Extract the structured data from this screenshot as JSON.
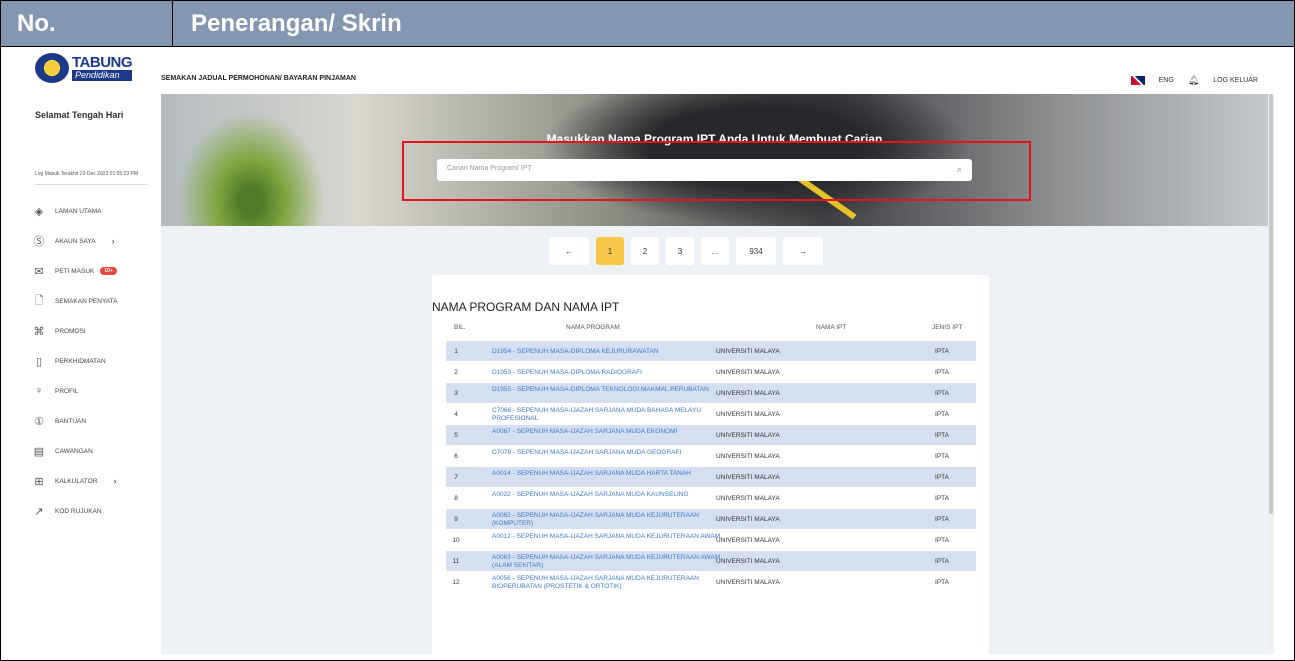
{
  "doc_header": {
    "no": "No.",
    "title": "Penerangan/ Skrin"
  },
  "topbar": {
    "logo_text": "TABUNG",
    "logo_sub": "Pendidikan",
    "app_title": "SEMAKAN JADUAL PERMOHONAN/ BAYARAN PINJAMAN",
    "lang": "ENG",
    "logout": "LOG KELUAR"
  },
  "sidebar": {
    "greeting": "Selamat Tengah Hari",
    "last_login": "Log Masuk Terakhir 29 Dec 2023 01:55:23 PM",
    "items": [
      {
        "label": "LAMAN UTAMA",
        "icon": "layers-icon"
      },
      {
        "label": "AKAUN SAYA",
        "icon": "dollar-icon",
        "chevron": "›"
      },
      {
        "label": "PETI MASUK",
        "icon": "mail-icon",
        "badge": "10+"
      },
      {
        "label": "SEMAKAN PENYATA",
        "icon": "document-icon"
      },
      {
        "label": "PROMOSI",
        "icon": "gift-icon"
      },
      {
        "label": "PERKHIDMATAN",
        "icon": "phone-icon"
      },
      {
        "label": "PROFIL",
        "icon": "user-icon"
      },
      {
        "label": "BANTUAN",
        "icon": "help-icon"
      },
      {
        "label": "CAWANGAN",
        "icon": "branch-icon"
      },
      {
        "label": "KALKULATOR",
        "icon": "calculator-icon",
        "chevron": "›"
      },
      {
        "label": "KOD RUJUKAN",
        "icon": "link-icon"
      }
    ]
  },
  "banner": {
    "heading": "Masukkan Nama Program IPT Anda Untuk Membuat Carian",
    "search_placeholder": "Carian Nama Program/ IPT"
  },
  "pagination": {
    "prev": "←",
    "pages": [
      "1",
      "2",
      "3",
      "...",
      "934"
    ],
    "next": "→",
    "active": "1"
  },
  "table": {
    "title": "NAMA PROGRAM DAN NAMA IPT",
    "headers": {
      "bil": "BIL.",
      "program": "NAMA PROGRAM",
      "ipt": "NAMA IPT",
      "jenis": "JENIS IPT"
    },
    "rows": [
      {
        "bil": "1",
        "program": "D1954 - SEPENUH MASA-DIPLOMA KEJURURAWATAN",
        "ipt": "UNIVERSITI MALAYA",
        "jenis": "IPTA"
      },
      {
        "bil": "2",
        "program": "D1953 - SEPENUH MASA-DIPLOMA RADIOGRAFI",
        "ipt": "UNIVERSITI MALAYA",
        "jenis": "IPTA"
      },
      {
        "bil": "3",
        "program": "D1955 - SEPENUH MASA-DIPLOMA TEKNOLOGI MAKMAL PERUBATAN",
        "ipt": "UNIVERSITI MALAYA",
        "jenis": "IPTA"
      },
      {
        "bil": "4",
        "program": "C7066 - SEPENUH MASA-IJAZAH SARJANA MUDA BAHASA MELAYU PROFESIONAL",
        "ipt": "UNIVERSITI MALAYA",
        "jenis": "IPTA"
      },
      {
        "bil": "5",
        "program": "A0067 - SEPENUH MASA-IJAZAH SARJANA MUDA EKONOMI",
        "ipt": "UNIVERSITI MALAYA",
        "jenis": "IPTA"
      },
      {
        "bil": "6",
        "program": "C7078 - SEPENUH MASA-IJAZAH SARJANA MUDA GEOGRAFI",
        "ipt": "UNIVERSITI MALAYA",
        "jenis": "IPTA"
      },
      {
        "bil": "7",
        "program": "A0014 - SEPENUH MASA-IJAZAH SARJANA MUDA HARTA TANAH",
        "ipt": "UNIVERSITI MALAYA",
        "jenis": "IPTA"
      },
      {
        "bil": "8",
        "program": "A0022 - SEPENUH MASA-IJAZAH SARJANA MUDA KAUNSELING",
        "ipt": "UNIVERSITI MALAYA",
        "jenis": "IPTA"
      },
      {
        "bil": "9",
        "program": "A0062 - SEPENUH MASA-IJAZAH SARJANA MUDA KEJURUTERAAN (KOMPUTER)",
        "ipt": "UNIVERSITI MALAYA",
        "jenis": "IPTA"
      },
      {
        "bil": "10",
        "program": "A0012 - SEPENUH MASA-IJAZAH SARJANA MUDA KEJURUTERAAN AWAM",
        "ipt": "UNIVERSITI MALAYA",
        "jenis": "IPTA"
      },
      {
        "bil": "11",
        "program": "A0063 - SEPENUH MASA-IJAZAH SARJANA MUDA KEJURUTERAAN AWAM (ALAM SEKITAR)",
        "ipt": "UNIVERSITI MALAYA",
        "jenis": "IPTA"
      },
      {
        "bil": "12",
        "program": "A0056 - SEPENUH MASA-IJAZAH SARJANA MUDA KEJURUTERAAN BIOPERUBATAN (PROSTETIK & ORTOTIK)",
        "ipt": "UNIVERSITI MALAYA",
        "jenis": "IPTA"
      }
    ]
  },
  "colors": {
    "header_bg": "#8497b0",
    "highlight": "#e3141b",
    "active_page": "#f7c84b",
    "link": "#3b7bd4",
    "row_alt": "#d5dff0"
  }
}
